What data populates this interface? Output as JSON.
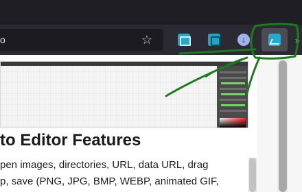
{
  "toolbar": {
    "url_fragment": "o",
    "bookmark_icon": "star-icon",
    "more_label": "»",
    "extensions": [
      {
        "name": "screen-capture-icon",
        "color": "#2aa6c8"
      },
      {
        "name": "frame-capture-icon",
        "color": "#22a3c4"
      },
      {
        "name": "download-icon",
        "color": "#9fb2ea"
      },
      {
        "name": "photo-editor-icon",
        "color": "#25a9cf"
      }
    ]
  },
  "article": {
    "heading": "to Editor Features",
    "paragraph_line_1": "pen images, directories, URL, data URL, drag",
    "paragraph_line_2": "p, save (PNG, JPG, BMP, WEBP, animated GIF,"
  },
  "annotation": {
    "color": "#1f7a1f",
    "description": "green pen circle around photo editor extension button"
  }
}
